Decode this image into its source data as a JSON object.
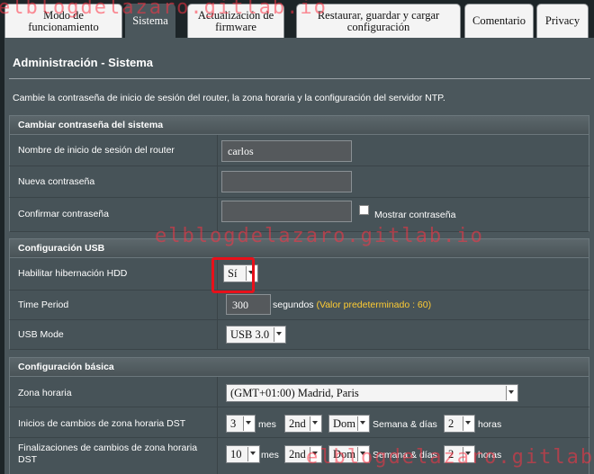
{
  "tabs": [
    {
      "label": "Modo de funcionamiento",
      "line1": "Modo de",
      "line2": "funcionamiento"
    },
    {
      "label": "Sistema"
    },
    {
      "label": "Actualización de firmware",
      "line1": "Actualización de",
      "line2": "firmware"
    },
    {
      "label": "Restaurar, guardar y cargar configuración",
      "line1": "Restaurar, guardar y cargar",
      "line2": "configuración"
    },
    {
      "label": "Comentario"
    },
    {
      "label": "Privacy"
    }
  ],
  "page": {
    "title": "Administración - Sistema",
    "description": "Cambie la contraseña de inicio de sesión del router, la zona horaria y la configuración del servidor NTP."
  },
  "password_section": {
    "header": "Cambiar contraseña del sistema",
    "router_login_label": "Nombre de inicio de sesión del router",
    "router_login_value": "carlos",
    "new_password_label": "Nueva contraseña",
    "new_password_value": "",
    "confirm_password_label": "Confirmar contraseña",
    "confirm_password_value": "",
    "show_password_label": "Mostrar contraseña"
  },
  "usb_section": {
    "header": "Configuración USB",
    "hdd_hibernation_label": "Habilitar hibernación HDD",
    "hdd_hibernation_value": "Sí",
    "time_period_label": "Time Period",
    "time_period_value": "300",
    "time_period_unit": "segundos",
    "time_period_hint": "(Valor predeterminado : 60)",
    "usb_mode_label": "USB Mode",
    "usb_mode_value": "USB 3.0"
  },
  "basic_section": {
    "header": "Configuración básica",
    "timezone_label": "Zona horaria",
    "timezone_value": "(GMT+01:00) Madrid, Paris",
    "dst_start_label": "Inicios de cambios de zona horaria DST",
    "dst_start": {
      "month": "3",
      "month_unit": "mes",
      "week": "2nd",
      "day": "Dom",
      "day_unit": "Semana & días",
      "hour": "2",
      "hour_unit": "horas"
    },
    "dst_end_label": "Finalizaciones de cambios de zona horaria DST",
    "dst_end": {
      "month": "10",
      "month_unit": "mes",
      "week": "2nd",
      "day": "Dom",
      "day_unit": "Semana & días",
      "hour": "2",
      "hour_unit": "horas"
    }
  },
  "watermark": "elblogdelazaro.gitlab.io",
  "colors": {
    "highlight": "#e8101a",
    "hint": "#ffcc33",
    "active_tab": "#4b575c"
  }
}
